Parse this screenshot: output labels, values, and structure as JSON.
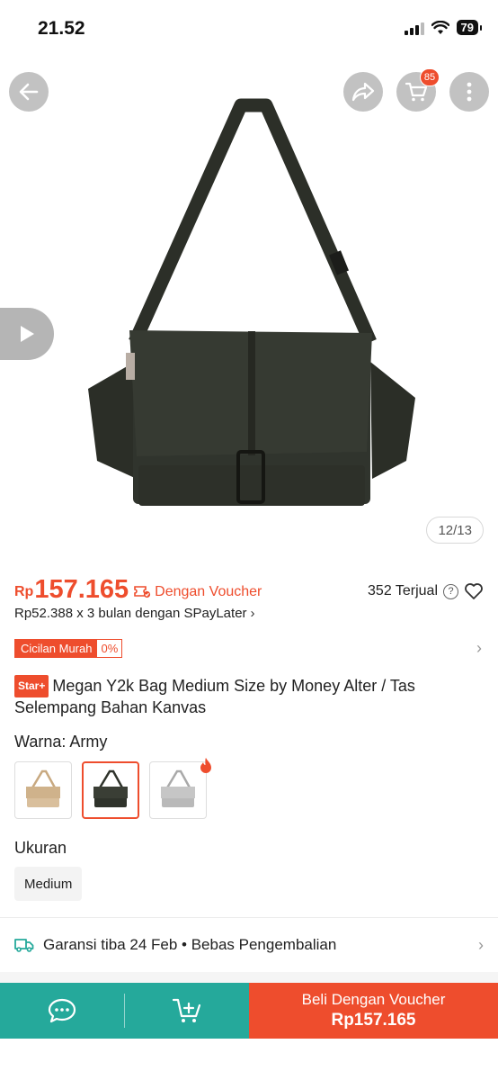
{
  "status": {
    "time": "21.52",
    "battery": "79"
  },
  "nav": {
    "cart_badge": "85"
  },
  "gallery": {
    "counter": "12/13"
  },
  "price": {
    "currency": "Rp",
    "value": "157.165",
    "voucher_label": "Dengan Voucher",
    "sold": "352 Terjual"
  },
  "paylater": {
    "text": "Rp52.388 x 3 bulan dengan SPayLater"
  },
  "cicilan": {
    "label": "Cicilan Murah",
    "percent": "0%"
  },
  "product": {
    "badge": "Star+",
    "title": "Megan Y2k Bag Medium Size by Money Alter / Tas Selempang Bahan Kanvas"
  },
  "variant": {
    "label": "Warna:",
    "selected": "Army",
    "options": [
      "Khaki",
      "Army",
      "Grey"
    ]
  },
  "size": {
    "label": "Ukuran",
    "option": "Medium"
  },
  "shipping": {
    "text": "Garansi tiba 24 Feb • Bebas Pengembalian"
  },
  "buy": {
    "label": "Beli Dengan Voucher",
    "price": "Rp157.165"
  },
  "colors": {
    "accent": "#ee4d2d",
    "teal": "#25a99b",
    "bag_army": "#2f332b",
    "bag_khaki": "#d9bf9c",
    "bag_grey": "#b9b9b9"
  }
}
